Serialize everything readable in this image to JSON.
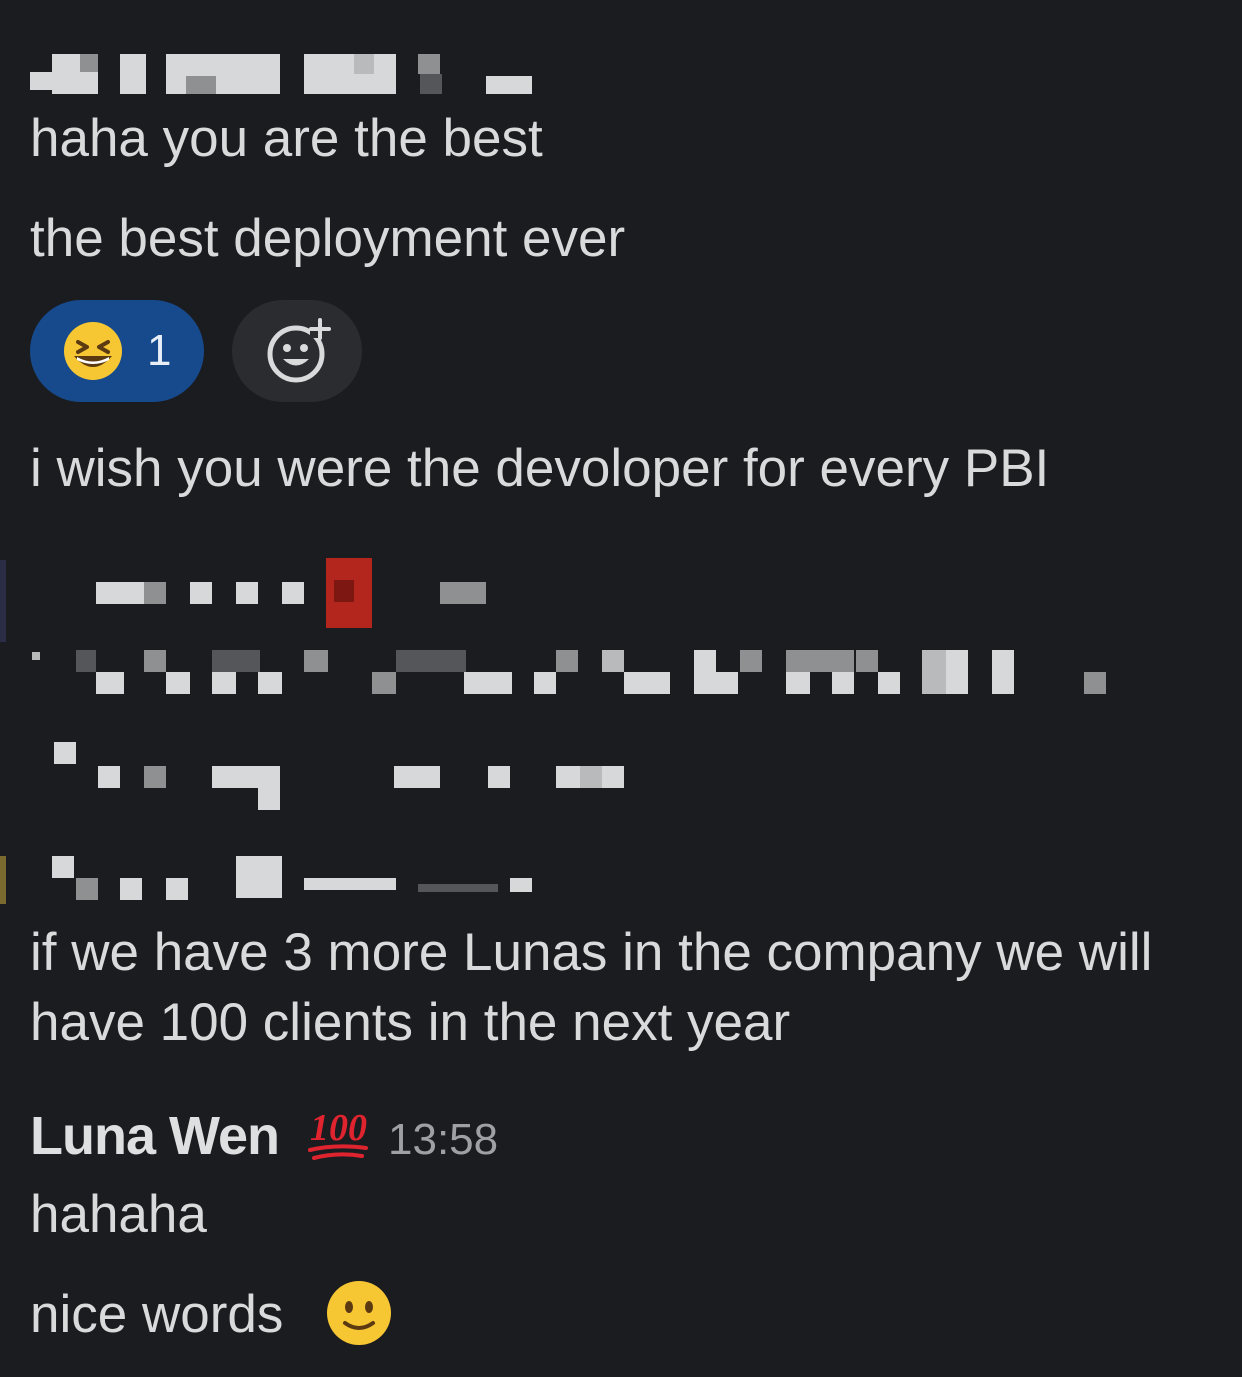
{
  "messages": [
    {
      "text": "haha you are the best"
    },
    {
      "text": "the best deployment ever"
    },
    {
      "text": "i wish you were the devoloper for every PBI"
    },
    {
      "text": "if we have 3 more Lunas in the company we will have 100 clients in the next year"
    }
  ],
  "reaction": {
    "emoji": "laughing-face-icon",
    "count": "1",
    "pill_color": "#174a8d"
  },
  "add_reaction": {
    "icon": "add-reaction-icon"
  },
  "reply": {
    "sender": "Luna Wen",
    "status_emoji": "hundred-points-icon",
    "timestamp": "13:58",
    "lines": [
      {
        "text": "hahaha"
      },
      {
        "text": "nice words",
        "emoji": "slightly-smiling-face-icon"
      }
    ]
  },
  "colors": {
    "background": "#1b1c1f",
    "text": "#d9dadb",
    "timestamp": "#9fa0a3"
  }
}
